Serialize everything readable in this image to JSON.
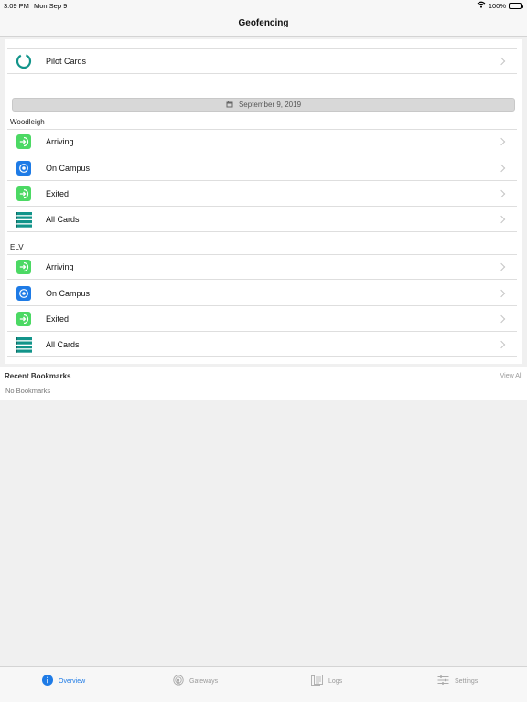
{
  "status_bar": {
    "time": "3:09 PM",
    "date": "Mon Sep 9",
    "battery": "100%"
  },
  "nav": {
    "title": "Geofencing"
  },
  "pilot": {
    "label": "Pilot Cards",
    "icon": "circle-ring-icon"
  },
  "date_pill": {
    "label": "September 9, 2019",
    "icon": "calendar-icon"
  },
  "groups": [
    {
      "name": "Woodleigh",
      "items": [
        {
          "label": "Arriving",
          "icon": "arrive-icon"
        },
        {
          "label": "On Campus",
          "icon": "location-dot-icon"
        },
        {
          "label": "Exited",
          "icon": "exit-icon"
        },
        {
          "label": "All Cards",
          "icon": "cards-stack-icon"
        }
      ]
    },
    {
      "name": "ELV",
      "items": [
        {
          "label": "Arriving",
          "icon": "arrive-icon"
        },
        {
          "label": "On Campus",
          "icon": "location-dot-icon"
        },
        {
          "label": "Exited",
          "icon": "exit-icon"
        },
        {
          "label": "All Cards",
          "icon": "cards-stack-icon"
        }
      ]
    }
  ],
  "bookmarks": {
    "heading": "Recent Bookmarks",
    "view_all": "View All",
    "empty": "No Bookmarks"
  },
  "tabs": [
    {
      "label": "Overview",
      "icon": "info-icon",
      "active": true
    },
    {
      "label": "Gateways",
      "icon": "broadcast-icon",
      "active": false
    },
    {
      "label": "Logs",
      "icon": "logs-icon",
      "active": false
    },
    {
      "label": "Settings",
      "icon": "sliders-icon",
      "active": false
    }
  ],
  "colors": {
    "accent": "#1e7be6",
    "green": "#4cd964",
    "teal": "#12948a"
  }
}
